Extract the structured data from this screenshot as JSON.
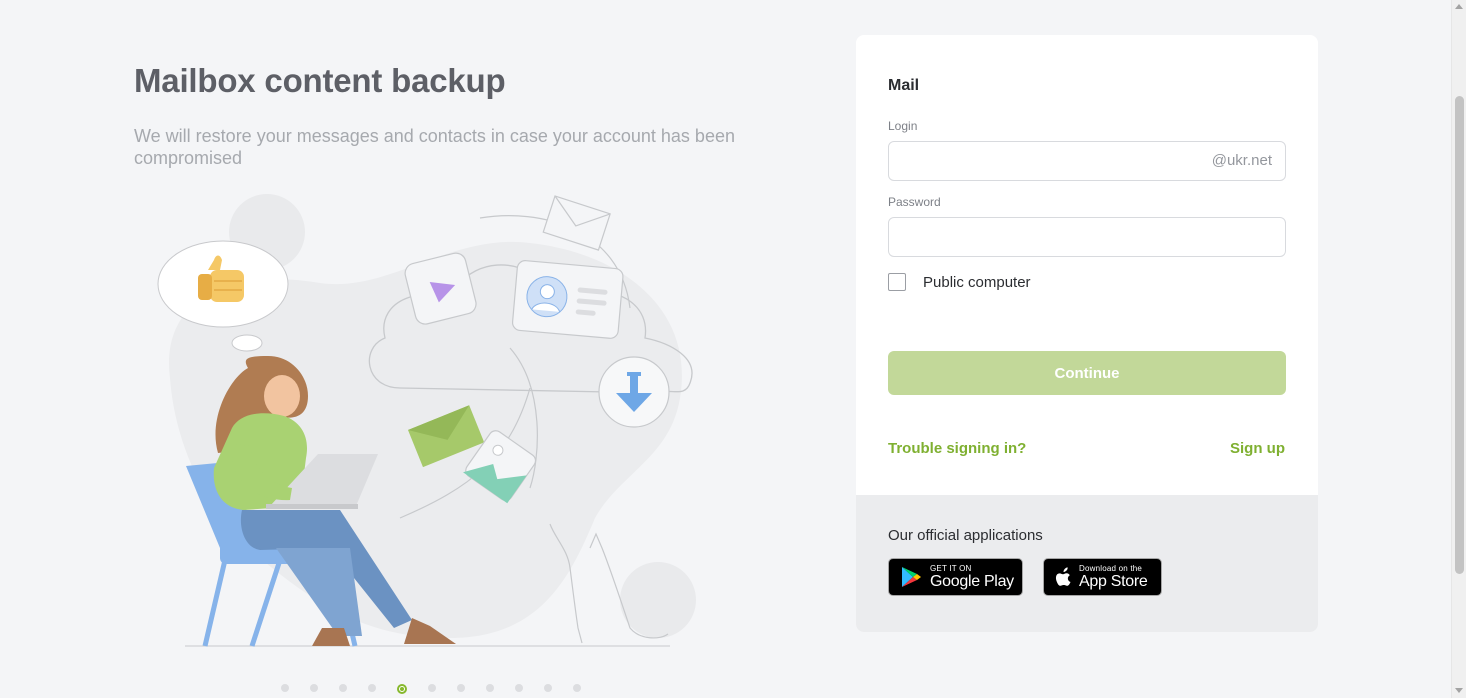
{
  "promo": {
    "title": "Mailbox content backup",
    "subtitle": "We will restore your messages and contacts in case your account has been compromised",
    "slides_total": 11,
    "active_slide": 5
  },
  "login_card": {
    "title": "Mail",
    "login_label": "Login",
    "login_value": "",
    "login_suffix": "@ukr.net",
    "password_label": "Password",
    "password_value": "",
    "public_computer_label": "Public computer",
    "public_computer_checked": false,
    "continue_label": "Continue",
    "trouble_link": "Trouble signing in?",
    "signup_link": "Sign up"
  },
  "apps": {
    "title": "Our official applications",
    "google_play": {
      "small": "GET IT ON",
      "big": "Google Play"
    },
    "app_store": {
      "small": "Download on the",
      "big": "App Store"
    }
  },
  "colors": {
    "accent": "#7fb031",
    "button_disabled": "#c2d899",
    "title": "#5d5f66"
  }
}
